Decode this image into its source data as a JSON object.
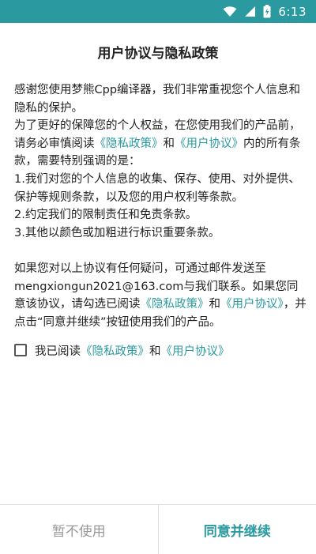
{
  "status_bar": {
    "time": "6:13",
    "icons": [
      "wifi-icon",
      "signal-icon",
      "battery-charging-icon"
    ],
    "color": "#2a9aa0"
  },
  "dialog": {
    "title": "用户协议与隐私政策",
    "p1": "感谢您使用梦熊Cpp编译器，我们非常重视您个人信息和隐私的保护。",
    "p2_a": "为了更好的保障您的个人权益，在您使用我们的产品前，请务必审慎阅读",
    "privacy_link": "《隐私政策》",
    "and": "和",
    "user_link": "《用户协议》",
    "p2_b": "内的所有条款，需要特别强调的是：",
    "list": [
      "1.我们对您的个人信息的收集、保存、使用、对外提供、保护等规则条款，以及您的用户权利等条款。",
      "2.约定我们的限制责任和免责条款。",
      "3.其他以颜色或加粗进行标识重要条款。"
    ],
    "p3_a": "如果您对以上协议有任何疑问，可通过邮件发送至mengxiongun2021@163.com与我们联系。如果您同意该协议，请勾选已阅读",
    "p3_b": "，并点击“同意并继续”按钮使用我们的产品。",
    "link_color": "#2a9aa0"
  },
  "agreement": {
    "prefix": "我已阅读",
    "privacy_link": "《隐私政策》",
    "and": "和",
    "user_link": "《用户协议》",
    "checked": false
  },
  "footer": {
    "decline_label": "暂不使用",
    "accept_label": "同意并继续"
  }
}
